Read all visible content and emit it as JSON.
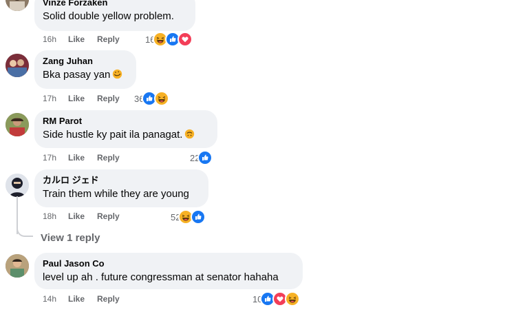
{
  "comments": [
    {
      "author": "Vinze Forzaken",
      "text": "Solid double yellow problem.",
      "time": "16h",
      "like_label": "Like",
      "reply_label": "Reply",
      "reaction_count": "16",
      "reactions": [
        "haha",
        "like",
        "love"
      ]
    },
    {
      "author": "Zang Juhan",
      "text": "Bka pasay yan",
      "inline_emoji": "rolling-laugh",
      "time": "17h",
      "like_label": "Like",
      "reply_label": "Reply",
      "reaction_count": "36",
      "reactions": [
        "like",
        "haha"
      ]
    },
    {
      "author": "RM Parot",
      "text": "Side hustle ky pait ila panagat.",
      "inline_emoji": "upside-down-face",
      "time": "17h",
      "like_label": "Like",
      "reply_label": "Reply",
      "reaction_count": "22",
      "reactions": [
        "like"
      ]
    },
    {
      "author": "カルロ ジェド",
      "text": "Train them while they are young",
      "time": "18h",
      "like_label": "Like",
      "reply_label": "Reply",
      "reaction_count": "52",
      "reactions": [
        "haha",
        "like"
      ]
    },
    {
      "author": "Paul Jason Co",
      "text": "level up ah . future congressman at senator hahaha",
      "time": "14h",
      "like_label": "Like",
      "reply_label": "Reply",
      "reaction_count": "10",
      "reactions": [
        "like",
        "love",
        "haha"
      ]
    }
  ],
  "view_replies_label": "View 1 reply",
  "colors": {
    "bubble": "#f0f2f5",
    "meta_text": "#65676b",
    "like_blue": "#1877f2",
    "love_red": "#f33e58",
    "haha_yellow": "#f7b125"
  }
}
